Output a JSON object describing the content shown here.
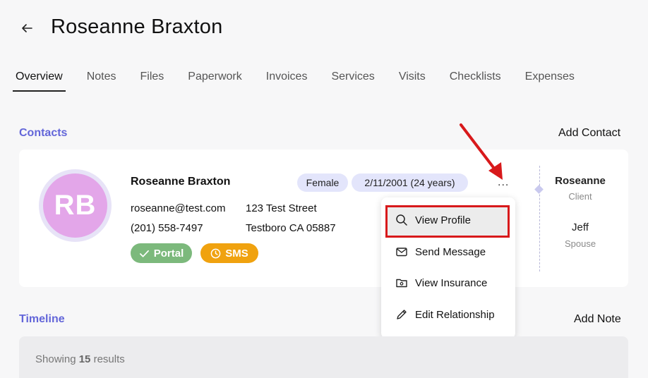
{
  "header": {
    "title": "Roseanne Braxton",
    "back_icon": "arrow-left-icon"
  },
  "tabs": [
    {
      "label": "Overview",
      "active": true
    },
    {
      "label": "Notes",
      "active": false
    },
    {
      "label": "Files",
      "active": false
    },
    {
      "label": "Paperwork",
      "active": false
    },
    {
      "label": "Invoices",
      "active": false
    },
    {
      "label": "Services",
      "active": false
    },
    {
      "label": "Visits",
      "active": false
    },
    {
      "label": "Checklists",
      "active": false
    },
    {
      "label": "Expenses",
      "active": false
    }
  ],
  "contacts": {
    "section_title": "Contacts",
    "add_label": "Add Contact",
    "card": {
      "initials": "RB",
      "name": "Roseanne Braxton",
      "gender": "Female",
      "dob": "2/11/2001 (24 years)",
      "email": "roseanne@test.com",
      "phone": "(201) 558-7497",
      "street": "123 Test Street",
      "city": "Testboro CA 05887",
      "portal_label": "Portal",
      "sms_label": "SMS",
      "more_label": "...",
      "relationships": [
        {
          "name": "Roseanne",
          "role": "Client"
        },
        {
          "name": "Jeff",
          "role": "Spouse"
        }
      ]
    }
  },
  "menu": {
    "items": [
      {
        "label": "View Profile",
        "icon": "search-icon",
        "highlighted": true
      },
      {
        "label": "Send Message",
        "icon": "mail-icon"
      },
      {
        "label": "View Insurance",
        "icon": "folder-icon"
      },
      {
        "label": "Edit Relationship",
        "icon": "pencil-icon"
      }
    ]
  },
  "timeline": {
    "section_title": "Timeline",
    "add_label": "Add Note",
    "showing_prefix": "Showing",
    "count": "15",
    "showing_suffix": "results"
  },
  "colors": {
    "accent": "#6366d9",
    "portal": "#7cb97c",
    "sms": "#f0a20f",
    "annotation": "#d8191b",
    "avatar": "#e3a6e9"
  }
}
